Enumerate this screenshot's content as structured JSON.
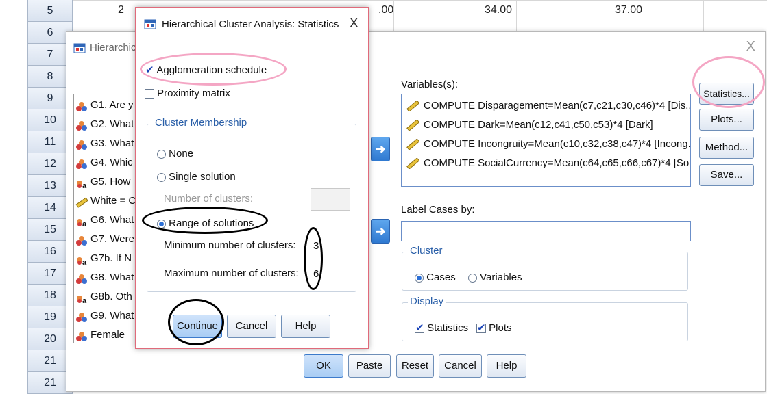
{
  "spreadsheet": {
    "row_numbers": [
      "5",
      "6",
      "7",
      "8",
      "9",
      "10",
      "11",
      "12",
      "13",
      "14",
      "15",
      "16",
      "17",
      "18",
      "19",
      "20",
      "21"
    ],
    "row5_cells": [
      "2",
      ".00",
      "34.00",
      "37.00"
    ]
  },
  "main_dialog": {
    "title": "Hierarchica",
    "close": "X",
    "source_variables": [
      {
        "label": "G1. Are y",
        "icon": "nominal-variable-icon"
      },
      {
        "label": "G2. What",
        "icon": "nominal-variable-icon"
      },
      {
        "label": "G3. What",
        "icon": "nominal-variable-icon"
      },
      {
        "label": "G4. Whic",
        "icon": "nominal-variable-icon"
      },
      {
        "label": "G5. How",
        "icon": "string-variable-icon"
      },
      {
        "label": "White = C",
        "icon": "scale-variable-icon"
      },
      {
        "label": "G6. What",
        "icon": "string-variable-icon"
      },
      {
        "label": "G7. Were",
        "icon": "nominal-variable-icon"
      },
      {
        "label": "G7b. If N",
        "icon": "string-variable-icon"
      },
      {
        "label": "G8. What",
        "icon": "nominal-variable-icon"
      },
      {
        "label": "G8b. Oth",
        "icon": "string-variable-icon"
      },
      {
        "label": "G9. What",
        "icon": "nominal-variable-icon"
      },
      {
        "label": "Female",
        "icon": "nominal-variable-icon"
      }
    ],
    "variables_label": "Variables(s):",
    "variables": [
      "COMPUTE Disparagement=Mean(c7,c21,c30,c46)*4 [Dis...",
      "COMPUTE Dark=Mean(c12,c41,c50,c53)*4 [Dark]",
      "COMPUTE Incongruity=Mean(c10,c32,c38,c47)*4 [Incong...",
      "COMPUTE SocialCurrency=Mean(c64,c65,c66,c67)*4 [So..."
    ],
    "label_cases_label": "Label Cases by:",
    "cluster_group": {
      "title": "Cluster",
      "cases": "Cases",
      "variables": "Variables",
      "selected": "Cases"
    },
    "display_group": {
      "title": "Display",
      "statistics": "Statistics",
      "plots": "Plots",
      "statistics_checked": true,
      "plots_checked": true
    },
    "side_buttons": {
      "statistics": "Statistics...",
      "plots": "Plots...",
      "method": "Method...",
      "save": "Save..."
    },
    "bottom_buttons": {
      "ok": "OK",
      "paste": "Paste",
      "reset": "Reset",
      "cancel": "Cancel",
      "help": "Help"
    }
  },
  "stats_dialog": {
    "title": "Hierarchical Cluster Analysis: Statistics",
    "close": "X",
    "agglomeration_schedule": {
      "label": "Agglomeration schedule",
      "checked": true
    },
    "proximity_matrix": {
      "label": "Proximity matrix",
      "checked": false
    },
    "cluster_membership": {
      "title": "Cluster Membership",
      "none": "None",
      "single": "Single solution",
      "number_of_clusters_label": "Number of clusters:",
      "range": "Range of solutions",
      "min_label": "Minimum number of clusters:",
      "max_label": "Maximum number of clusters:",
      "min_value": "3",
      "max_value": "6",
      "selected": "Range of solutions"
    },
    "buttons": {
      "continue": "Continue",
      "cancel": "Cancel",
      "help": "Help"
    }
  },
  "colors": {
    "pink_annotation": "#f4a6c4",
    "black_annotation": "#000000",
    "accent_blue": "#2b6fd6"
  }
}
